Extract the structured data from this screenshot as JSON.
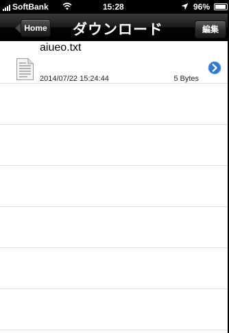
{
  "status_bar": {
    "carrier": "SoftBank",
    "time": "15:28",
    "battery": "96%",
    "battery_level": 0.96,
    "signal_icon": "signal-bars-icon",
    "wifi_icon": "wifi-icon",
    "location_icon": "location-arrow-icon"
  },
  "nav": {
    "back_label": "Home",
    "title": "ダウンロード",
    "edit_label": "編集"
  },
  "files": [
    {
      "name": "aiueo.txt",
      "date": "2014/07/22 15:24:44",
      "size": "5 Bytes",
      "icon": "text-file-icon",
      "accessory": "detail-disclosure-icon"
    }
  ],
  "colors": {
    "nav_bar": "#1a1a1a",
    "disclosure_blue": "#2f76d9",
    "divider": "#e0e0e0"
  }
}
